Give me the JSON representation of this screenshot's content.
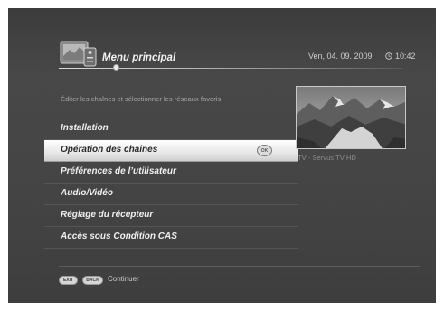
{
  "header": {
    "title": "Menu principal",
    "date": "Ven, 04. 09. 2009",
    "time": "10:42"
  },
  "description": "Éditer les chaînes et sélectionner les réseaux favoris.",
  "menu": {
    "items": [
      {
        "label": "Installation",
        "selected": false
      },
      {
        "label": "Opération des chaînes",
        "selected": true
      },
      {
        "label": "Préférences de l’utilisateur",
        "selected": false
      },
      {
        "label": "Audio/Vidéo",
        "selected": false
      },
      {
        "label": "Réglage du récepteur",
        "selected": false
      },
      {
        "label": "Accès sous Condition CAS",
        "selected": false
      }
    ],
    "ok_badge": "OK"
  },
  "preview": {
    "caption": "TV - Servus TV HD"
  },
  "footer": {
    "exit_key": "EXIT",
    "back_key": "BACK",
    "continue_label": "Continuer"
  }
}
